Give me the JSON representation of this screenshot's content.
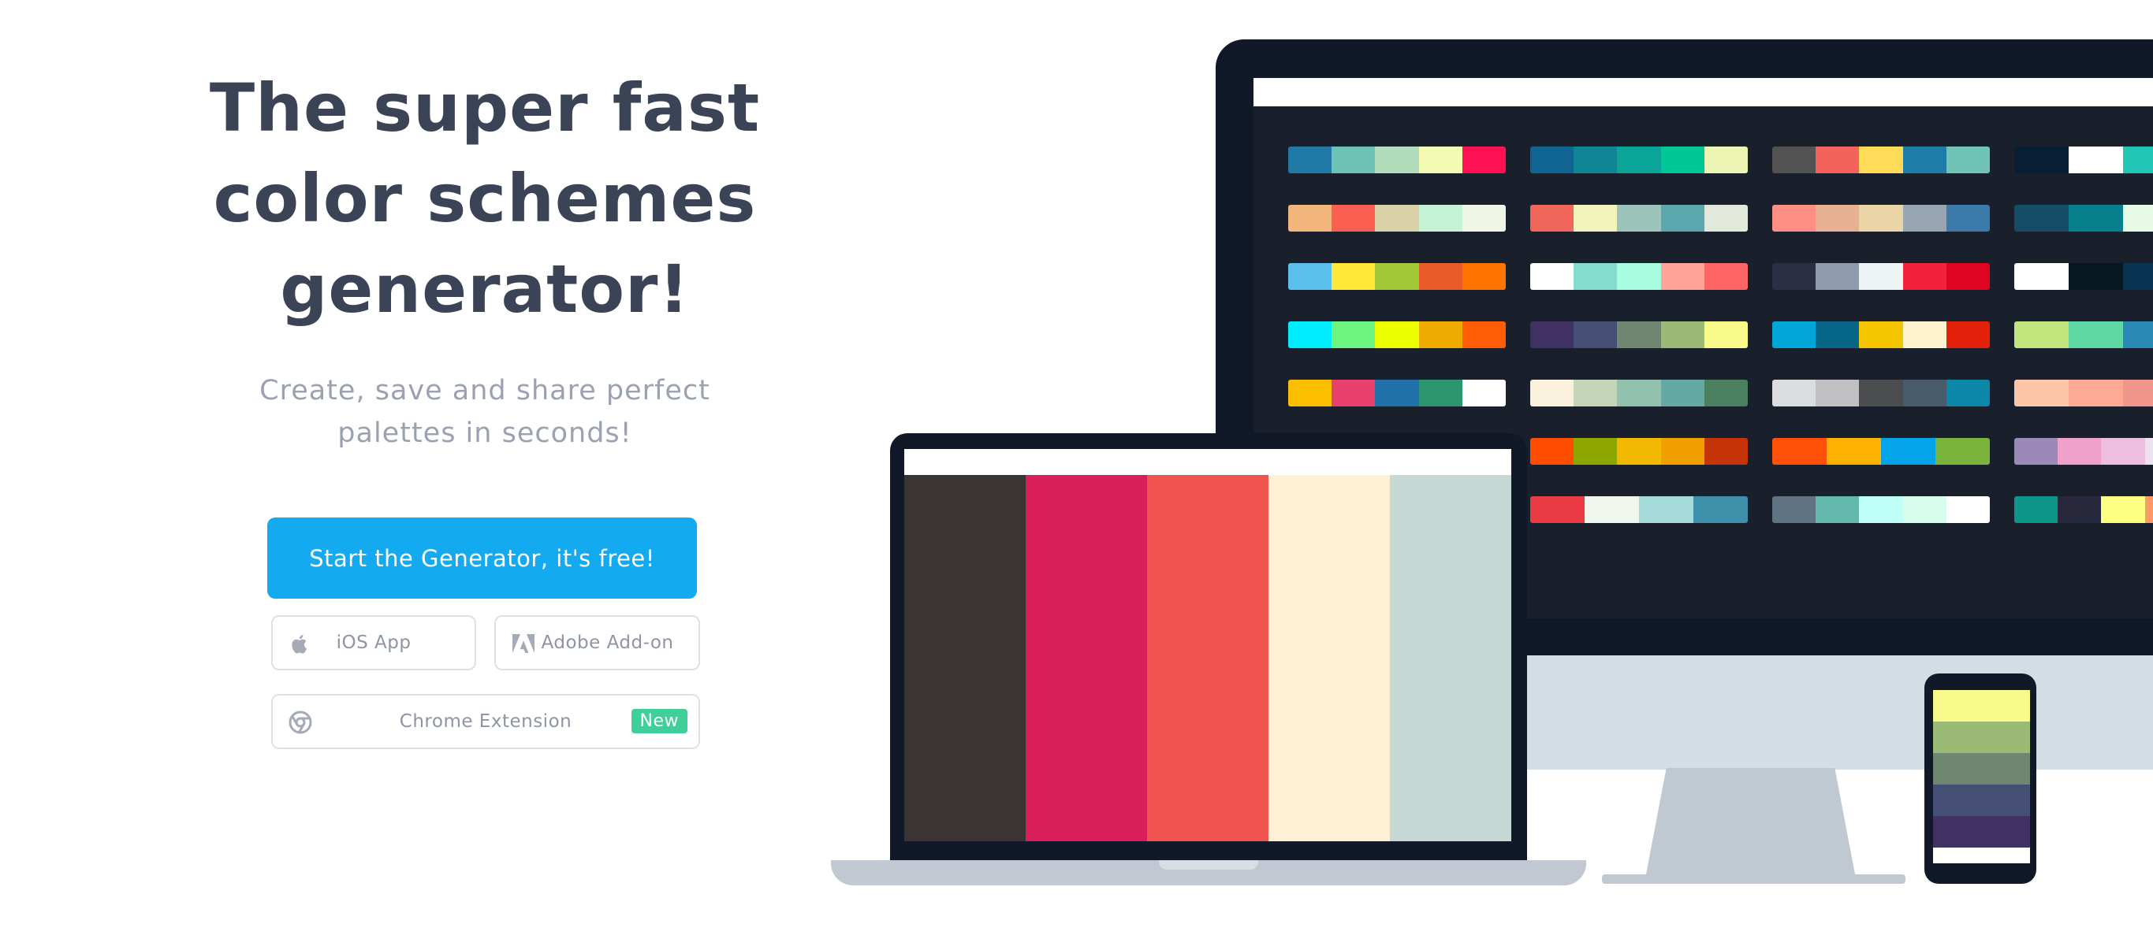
{
  "hero": {
    "headline_line1": "The super fast",
    "headline_line2": "color schemes",
    "headline_line3": "generator!",
    "subhead_line1": "Create, save and share perfect",
    "subhead_line2": "palettes in seconds!"
  },
  "cta": {
    "primary_label": "Start the Generator, it's free!",
    "ios_label": "iOS App",
    "adobe_label": "Adobe Add-on",
    "chrome_label": "Chrome Extension",
    "chrome_badge": "New"
  },
  "colors": {
    "primary_button": "#13aaf0",
    "headline": "#3b4357",
    "subhead": "#9aa2b1",
    "new_badge": "#3fcf98",
    "device_dark": "#111827"
  },
  "icons": {
    "ios": "apple-icon",
    "adobe": "adobe-icon",
    "chrome": "chrome-icon"
  },
  "monitor_palettes": [
    [
      "#2179a5",
      "#6cc3b5",
      "#b3dcbc",
      "#f3fab4",
      "#ff1152"
    ],
    [
      "#0f6491",
      "#0f8596",
      "#0aa597",
      "#00c796",
      "#ecf4b4"
    ],
    [
      "#525252",
      "#f4625b",
      "#ffdb58",
      "#1f7ba8",
      "#6fc4b5"
    ],
    [
      "#081e34",
      "#ffffff",
      "#21c7b4",
      "#f2353e"
    ],
    [
      "#f2b57c",
      "#fa5f52",
      "#d9d2a8",
      "#c6f2d5",
      "#f0f6e3"
    ],
    [
      "#f0665a",
      "#f3f4bc",
      "#9dc4bb",
      "#5aa8ae",
      "#e3e8dc"
    ],
    [
      "#fe8f85",
      "#e9b193",
      "#ebd5a7",
      "#97a6b2",
      "#3c7ba9"
    ],
    [
      "#154d66",
      "#087f8c",
      "#e6f9e5",
      "#29a3c0"
    ],
    [
      "#5abfeb",
      "#fee737",
      "#a0c735",
      "#e95c2a",
      "#ff7303"
    ],
    [
      "#ffffff",
      "#84dccc",
      "#a8fce0",
      "#ffa499",
      "#fe6565"
    ],
    [
      "#2a2f45",
      "#8f9cb0",
      "#eef4f5",
      "#f3213a",
      "#de0520"
    ],
    [
      "#ffffff",
      "#071821",
      "#083352",
      "#0e83c0"
    ],
    [
      "#00edff",
      "#6df582",
      "#ecfe00",
      "#edaa00",
      "#ff5c05"
    ],
    [
      "#3f3161",
      "#454f76",
      "#6f8770",
      "#9aba75",
      "#f8fb8a"
    ],
    [
      "#00a7d6",
      "#076688",
      "#f5c500",
      "#fff3cf",
      "#e3200a"
    ],
    [
      "#c0e67d",
      "#5ed8a4",
      "#2b89b5",
      "#6c84b6"
    ],
    [
      "#fbbf00",
      "#e9416d",
      "#2071aa",
      "#2e956f",
      "#ffffff"
    ],
    [
      "#faf1dc",
      "#c4d6b7",
      "#92c1ad",
      "#66a8a6",
      "#4a8060"
    ],
    [
      "#dadce0",
      "#c0c0c3",
      "#4b4d4e",
      "#485c6c",
      "#0d87a7"
    ],
    [
      "#fec6a9",
      "#fea993",
      "#f0968c",
      "#e17d88"
    ],
    [
      "#d6ded7",
      "#fde5db",
      "#fdc7d2",
      "#f6a7b2",
      "#a67f8a"
    ],
    [
      "#ff4d00",
      "#8da600",
      "#f2b900",
      "#f09e00",
      "#c43406"
    ],
    [
      "#fe5007",
      "#feb100",
      "#04a5e8",
      "#7bb43c"
    ],
    [
      "#9b8ab9",
      "#f0a1ca",
      "#eebee1",
      "#ece3ef",
      "#b5bcdc"
    ],
    [
      "#c8f9e1",
      "#e1befb",
      "#f785c2",
      "#eee99e",
      "#a6ddf8"
    ],
    [
      "#ea3b44",
      "#f0f6ec",
      "#a5dcdb",
      "#3e8fa9"
    ],
    [
      "#5f7383",
      "#62b8ad",
      "#bffff8",
      "#d8fdec",
      "#ffffff"
    ],
    [
      "#0c9689",
      "#27283c",
      "#fdff82",
      "#fb9a67",
      "#ef4b57"
    ],
    [
      "#7d3047",
      "#e6b7a4",
      "#f6e8de",
      "#dfd6cc"
    ]
  ],
  "laptop_palette": [
    "#3b3435",
    "#d81e5b",
    "#f0544f",
    "#fdf0d5",
    "#c6d8d3"
  ],
  "phone_palette": [
    "#f8fb8a",
    "#9aba75",
    "#6f8770",
    "#454f76",
    "#3f3161"
  ]
}
